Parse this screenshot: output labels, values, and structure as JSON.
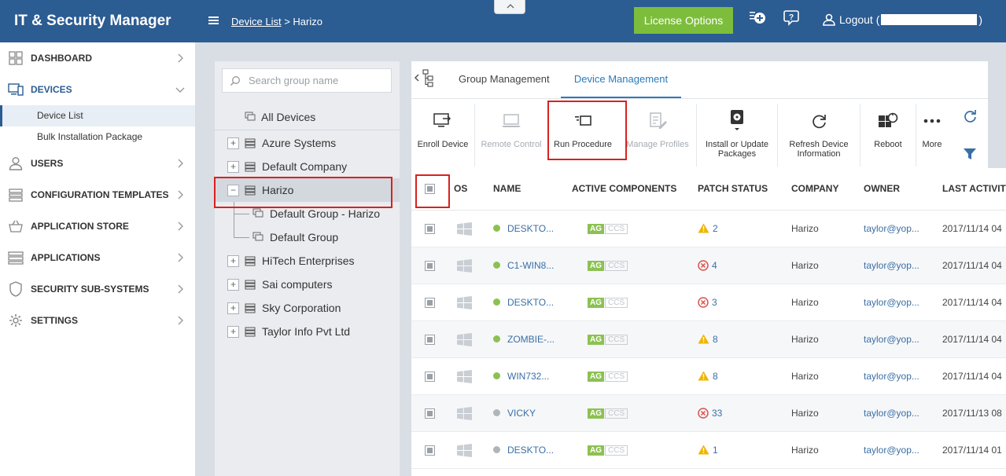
{
  "app": {
    "title": "IT & Security Manager"
  },
  "topbar": {
    "breadcrumb_link": "Device List",
    "breadcrumb_sep": " > ",
    "breadcrumb_current": "Harizo",
    "license_button": "License Options",
    "logout_prefix": "Logout (",
    "logout_suffix": ")"
  },
  "sidebar": {
    "items": [
      {
        "label": "DASHBOARD",
        "icon": "dashboard-icon"
      },
      {
        "label": "DEVICES",
        "icon": "devices-icon"
      },
      {
        "label": "USERS",
        "icon": "users-icon"
      },
      {
        "label": "CONFIGURATION TEMPLATES",
        "icon": "templates-icon"
      },
      {
        "label": "APPLICATION STORE",
        "icon": "store-icon"
      },
      {
        "label": "APPLICATIONS",
        "icon": "applications-icon"
      },
      {
        "label": "SECURITY SUB-SYSTEMS",
        "icon": "shield-icon"
      },
      {
        "label": "SETTINGS",
        "icon": "gear-icon"
      }
    ],
    "devices_sub": [
      "Device List",
      "Bulk Installation Package"
    ]
  },
  "groups": {
    "search_placeholder": "Search group name",
    "all_devices": "All Devices",
    "tree": [
      {
        "label": "Azure Systems",
        "toggle": "+"
      },
      {
        "label": "Default Company",
        "toggle": "+"
      },
      {
        "label": "Harizo",
        "toggle": "−"
      },
      {
        "label": "HiTech Enterprises",
        "toggle": "+"
      },
      {
        "label": "Sai computers",
        "toggle": "+"
      },
      {
        "label": "Sky Corporation",
        "toggle": "+"
      },
      {
        "label": "Taylor Info Pvt Ltd",
        "toggle": "+"
      }
    ],
    "harizo_children": [
      "Default Group - Harizo",
      "Default Group"
    ]
  },
  "tabs": [
    "Group Management",
    "Device Management"
  ],
  "toolbar": {
    "enroll": "Enroll Device",
    "remote": "Remote Control",
    "run_procedure": "Run Procedure",
    "manage_profiles": "Manage Profiles",
    "install_line1": "Install or Update",
    "install_line2": "Packages",
    "refresh_line1": "Refresh Device",
    "refresh_line2": "Information",
    "reboot": "Reboot",
    "more": "More"
  },
  "table": {
    "headers": [
      "OS",
      "NAME",
      "ACTIVE COMPONENTS",
      "PATCH STATUS",
      "COMPANY",
      "OWNER",
      "LAST ACTIVITY"
    ],
    "badge_ag": "AG",
    "badge_ccs": "CCS",
    "rows": [
      {
        "name": "DESKTO...",
        "online": true,
        "patch_type": "warning",
        "patch": "2",
        "company": "Harizo",
        "owner": "taylor@yop...",
        "last": "2017/11/14 04"
      },
      {
        "name": "C1-WIN8...",
        "online": true,
        "patch_type": "error",
        "patch": "4",
        "company": "Harizo",
        "owner": "taylor@yop...",
        "last": "2017/11/14 04"
      },
      {
        "name": "DESKTO...",
        "online": true,
        "patch_type": "error",
        "patch": "3",
        "company": "Harizo",
        "owner": "taylor@yop...",
        "last": "2017/11/14 04"
      },
      {
        "name": "ZOMBIE-...",
        "online": true,
        "patch_type": "warning",
        "patch": "8",
        "company": "Harizo",
        "owner": "taylor@yop...",
        "last": "2017/11/14 04"
      },
      {
        "name": "WIN732...",
        "online": true,
        "patch_type": "warning",
        "patch": "8",
        "company": "Harizo",
        "owner": "taylor@yop...",
        "last": "2017/11/14 04"
      },
      {
        "name": "VICKY",
        "online": false,
        "patch_type": "error",
        "patch": "33",
        "company": "Harizo",
        "owner": "taylor@yop...",
        "last": "2017/11/13 08"
      },
      {
        "name": "DESKTO...",
        "online": false,
        "patch_type": "warning",
        "patch": "1",
        "company": "Harizo",
        "owner": "taylor@yop...",
        "last": "2017/11/14 01"
      }
    ]
  },
  "colors": {
    "brand": "#2b5c92",
    "online": "#8cc152",
    "offline": "#b0b5ba",
    "warning": "#f0b400",
    "error": "#d9534f",
    "highlight": "#d9211f"
  }
}
